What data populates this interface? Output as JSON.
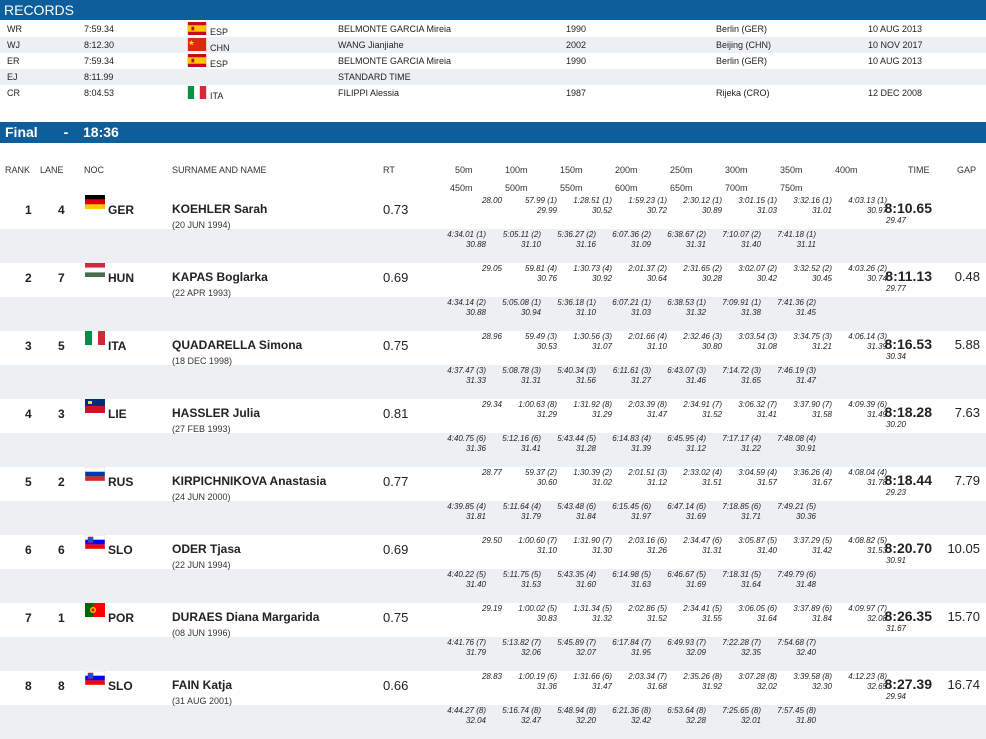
{
  "records_title": "RECORDS",
  "records": [
    {
      "code": "WR",
      "time": "7:59.34",
      "noc": "ESP",
      "flag": "flag-esp",
      "name": "BELMONTE GARCIA Mireia",
      "year": "1990",
      "place": "Berlin (GER)",
      "date": "10 AUG 2013"
    },
    {
      "code": "WJ",
      "time": "8:12.30",
      "noc": "CHN",
      "flag": "flag-chn",
      "name": "WANG Jianjiahe",
      "year": "2002",
      "place": "Beijing (CHN)",
      "date": "10 NOV 2017"
    },
    {
      "code": "ER",
      "time": "7:59.34",
      "noc": "ESP",
      "flag": "flag-esp",
      "name": "BELMONTE GARCIA Mireia",
      "year": "1990",
      "place": "Berlin (GER)",
      "date": "10 AUG 2013"
    },
    {
      "code": "EJ",
      "time": "8:11.99",
      "noc": "",
      "flag": "",
      "name": "STANDARD TIME",
      "year": "",
      "place": "",
      "date": ""
    },
    {
      "code": "CR",
      "time": "8:04.53",
      "noc": "ITA",
      "flag": "flag-ita",
      "name": "FILIPPI Alessia",
      "year": "1987",
      "place": "Rijeka (CRO)",
      "date": "12 DEC 2008"
    }
  ],
  "final": {
    "label": "Final",
    "separator": "-",
    "time": "18:36"
  },
  "headers": {
    "rank": "RANK",
    "lane": "LANE",
    "noc": "NOC",
    "name": "SURNAME AND NAME",
    "rt": "RT",
    "splits_top": [
      "50m",
      "100m",
      "150m",
      "200m",
      "250m",
      "300m",
      "350m",
      "400m"
    ],
    "splits_bottom": [
      "450m",
      "500m",
      "550m",
      "600m",
      "650m",
      "700m",
      "750m"
    ],
    "time": "TIME",
    "gap": "GAP"
  },
  "athletes": [
    {
      "rank": "1",
      "lane": "4",
      "noc": "GER",
      "flag": "flag-ger",
      "name": "KOEHLER Sarah",
      "dob": "(20 JUN 1994)",
      "rt": "0.73",
      "time": "8:10.65",
      "lap": "29.47",
      "gap": "",
      "top": [
        [
          "28.00",
          ""
        ],
        [
          "57.99 (1)",
          "29.99"
        ],
        [
          "1:28.51 (1)",
          "30.52"
        ],
        [
          "1:59.23 (1)",
          "30.72"
        ],
        [
          "2:30.12 (1)",
          "30.89"
        ],
        [
          "3:01.15 (1)",
          "31.03"
        ],
        [
          "3:32.16 (1)",
          "31.01"
        ],
        [
          "4:03.13 (1)",
          "30.97"
        ]
      ],
      "bottom": [
        [
          "4:34.01 (1)",
          "30.88"
        ],
        [
          "5:05.11 (2)",
          "31.10"
        ],
        [
          "5:36.27 (2)",
          "31.16"
        ],
        [
          "6:07.36 (2)",
          "31.09"
        ],
        [
          "6:38.67 (2)",
          "31.31"
        ],
        [
          "7:10.07 (2)",
          "31.40"
        ],
        [
          "7:41.18 (1)",
          "31.11"
        ]
      ]
    },
    {
      "rank": "2",
      "lane": "7",
      "noc": "HUN",
      "flag": "flag-hun",
      "name": "KAPAS Boglarka",
      "dob": "(22 APR 1993)",
      "rt": "0.69",
      "time": "8:11.13",
      "lap": "29.77",
      "gap": "0.48",
      "top": [
        [
          "29.05",
          ""
        ],
        [
          "59.81 (4)",
          "30.76"
        ],
        [
          "1:30.73 (4)",
          "30.92"
        ],
        [
          "2:01.37 (2)",
          "30.64"
        ],
        [
          "2:31.65 (2)",
          "30.28"
        ],
        [
          "3:02.07 (2)",
          "30.42"
        ],
        [
          "3:32.52 (2)",
          "30.45"
        ],
        [
          "4:03.26 (2)",
          "30.74"
        ]
      ],
      "bottom": [
        [
          "4:34.14 (2)",
          "30.88"
        ],
        [
          "5:05.08 (1)",
          "30.94"
        ],
        [
          "5:36.18 (1)",
          "31.10"
        ],
        [
          "6:07.21 (1)",
          "31.03"
        ],
        [
          "6:38.53 (1)",
          "31.32"
        ],
        [
          "7:09.91 (1)",
          "31.38"
        ],
        [
          "7:41.36 (2)",
          "31.45"
        ]
      ]
    },
    {
      "rank": "3",
      "lane": "5",
      "noc": "ITA",
      "flag": "flag-ita",
      "name": "QUADARELLA Simona",
      "dob": "(18 DEC 1998)",
      "rt": "0.75",
      "time": "8:16.53",
      "lap": "30.34",
      "gap": "5.88",
      "top": [
        [
          "28.96",
          ""
        ],
        [
          "59.49 (3)",
          "30.53"
        ],
        [
          "1:30.56 (3)",
          "31.07"
        ],
        [
          "2:01.66 (4)",
          "31.10"
        ],
        [
          "2:32.46 (3)",
          "30.80"
        ],
        [
          "3:03.54 (3)",
          "31.08"
        ],
        [
          "3:34.75 (3)",
          "31.21"
        ],
        [
          "4:06.14 (3)",
          "31.39"
        ]
      ],
      "bottom": [
        [
          "4:37.47 (3)",
          "31.33"
        ],
        [
          "5:08.78 (3)",
          "31.31"
        ],
        [
          "5:40.34 (3)",
          "31.56"
        ],
        [
          "6:11.61 (3)",
          "31.27"
        ],
        [
          "6:43.07 (3)",
          "31.46"
        ],
        [
          "7:14.72 (3)",
          "31.65"
        ],
        [
          "7:46.19 (3)",
          "31.47"
        ]
      ]
    },
    {
      "rank": "4",
      "lane": "3",
      "noc": "LIE",
      "flag": "flag-lie",
      "name": "HASSLER Julia",
      "dob": "(27 FEB 1993)",
      "rt": "0.81",
      "time": "8:18.28",
      "lap": "30.20",
      "gap": "7.63",
      "top": [
        [
          "29.34",
          ""
        ],
        [
          "1:00.63 (8)",
          "31.29"
        ],
        [
          "1:31.92 (8)",
          "31.29"
        ],
        [
          "2:03.39 (8)",
          "31.47"
        ],
        [
          "2:34.91 (7)",
          "31.52"
        ],
        [
          "3:06.32 (7)",
          "31.41"
        ],
        [
          "3:37.90 (7)",
          "31.58"
        ],
        [
          "4:09.39 (6)",
          "31.49"
        ]
      ],
      "bottom": [
        [
          "4:40.75 (6)",
          "31.36"
        ],
        [
          "5:12.16 (6)",
          "31.41"
        ],
        [
          "5:43.44 (5)",
          "31.28"
        ],
        [
          "6:14.83 (4)",
          "31.39"
        ],
        [
          "6:45.95 (4)",
          "31.12"
        ],
        [
          "7:17.17 (4)",
          "31.22"
        ],
        [
          "7:48.08 (4)",
          "30.91"
        ]
      ]
    },
    {
      "rank": "5",
      "lane": "2",
      "noc": "RUS",
      "flag": "flag-rus",
      "name": "KIRPICHNIKOVA Anastasia",
      "dob": "(24 JUN 2000)",
      "rt": "0.77",
      "time": "8:18.44",
      "lap": "29.23",
      "gap": "7.79",
      "top": [
        [
          "28.77",
          ""
        ],
        [
          "59.37 (2)",
          "30.60"
        ],
        [
          "1:30.39 (2)",
          "31.02"
        ],
        [
          "2:01.51 (3)",
          "31.12"
        ],
        [
          "2:33.02 (4)",
          "31.51"
        ],
        [
          "3:04.59 (4)",
          "31.57"
        ],
        [
          "3:36.26 (4)",
          "31.67"
        ],
        [
          "4:08.04 (4)",
          "31.78"
        ]
      ],
      "bottom": [
        [
          "4:39.85 (4)",
          "31.81"
        ],
        [
          "5:11.64 (4)",
          "31.79"
        ],
        [
          "5:43.48 (6)",
          "31.84"
        ],
        [
          "6:15.45 (6)",
          "31.97"
        ],
        [
          "6:47.14 (6)",
          "31.69"
        ],
        [
          "7:18.85 (6)",
          "31.71"
        ],
        [
          "7:49.21 (5)",
          "30.36"
        ]
      ]
    },
    {
      "rank": "6",
      "lane": "6",
      "noc": "SLO",
      "flag": "flag-slo",
      "name": "ODER Tjasa",
      "dob": "(22 JUN 1994)",
      "rt": "0.69",
      "time": "8:20.70",
      "lap": "30.91",
      "gap": "10.05",
      "top": [
        [
          "29.50",
          ""
        ],
        [
          "1:00.60 (7)",
          "31.10"
        ],
        [
          "1:31.90 (7)",
          "31.30"
        ],
        [
          "2:03.16 (6)",
          "31.26"
        ],
        [
          "2:34.47 (6)",
          "31.31"
        ],
        [
          "3:05.87 (5)",
          "31.40"
        ],
        [
          "3:37.29 (5)",
          "31.42"
        ],
        [
          "4:08.82 (5)",
          "31.53"
        ]
      ],
      "bottom": [
        [
          "4:40.22 (5)",
          "31.40"
        ],
        [
          "5:11.75 (5)",
          "31.53"
        ],
        [
          "5:43.35 (4)",
          "31.60"
        ],
        [
          "6:14.98 (5)",
          "31.63"
        ],
        [
          "6:46.67 (5)",
          "31.69"
        ],
        [
          "7:18.31 (5)",
          "31.64"
        ],
        [
          "7:49.79 (6)",
          "31.48"
        ]
      ]
    },
    {
      "rank": "7",
      "lane": "1",
      "noc": "POR",
      "flag": "flag-por",
      "name": "DURAES Diana Margarida",
      "dob": "(08 JUN 1996)",
      "rt": "0.75",
      "time": "8:26.35",
      "lap": "31.67",
      "gap": "15.70",
      "top": [
        [
          "29.19",
          ""
        ],
        [
          "1:00.02 (5)",
          "30.83"
        ],
        [
          "1:31.34 (5)",
          "31.32"
        ],
        [
          "2:02.86 (5)",
          "31.52"
        ],
        [
          "2:34.41 (5)",
          "31.55"
        ],
        [
          "3:06.05 (6)",
          "31.64"
        ],
        [
          "3:37.89 (6)",
          "31.84"
        ],
        [
          "4:09.97 (7)",
          "32.08"
        ]
      ],
      "bottom": [
        [
          "4:41.76 (7)",
          "31.79"
        ],
        [
          "5:13.82 (7)",
          "32.06"
        ],
        [
          "5:45.89 (7)",
          "32.07"
        ],
        [
          "6:17.84 (7)",
          "31.95"
        ],
        [
          "6:49.93 (7)",
          "32.09"
        ],
        [
          "7:22.28 (7)",
          "32.35"
        ],
        [
          "7:54.68 (7)",
          "32.40"
        ]
      ]
    },
    {
      "rank": "8",
      "lane": "8",
      "noc": "SLO",
      "flag": "flag-slo",
      "name": "FAIN Katja",
      "dob": "(31 AUG 2001)",
      "rt": "0.66",
      "time": "8:27.39",
      "lap": "29.94",
      "gap": "16.74",
      "top": [
        [
          "28.83",
          ""
        ],
        [
          "1:00.19 (6)",
          "31.36"
        ],
        [
          "1:31.66 (6)",
          "31.47"
        ],
        [
          "2:03.34 (7)",
          "31.68"
        ],
        [
          "2:35.26 (8)",
          "31.92"
        ],
        [
          "3:07.28 (8)",
          "32.02"
        ],
        [
          "3:39.58 (8)",
          "32.30"
        ],
        [
          "4:12.23 (8)",
          "32.65"
        ]
      ],
      "bottom": [
        [
          "4:44.27 (8)",
          "32.04"
        ],
        [
          "5:16.74 (8)",
          "32.47"
        ],
        [
          "5:48.94 (8)",
          "32.20"
        ],
        [
          "6:21.36 (8)",
          "32.42"
        ],
        [
          "6:53.64 (8)",
          "32.28"
        ],
        [
          "7:25.65 (8)",
          "32.01"
        ],
        [
          "7:57.45 (8)",
          "31.80"
        ]
      ]
    }
  ],
  "colors": {
    "bar": "#0d5e9b",
    "shade": "#ecf0f3"
  }
}
